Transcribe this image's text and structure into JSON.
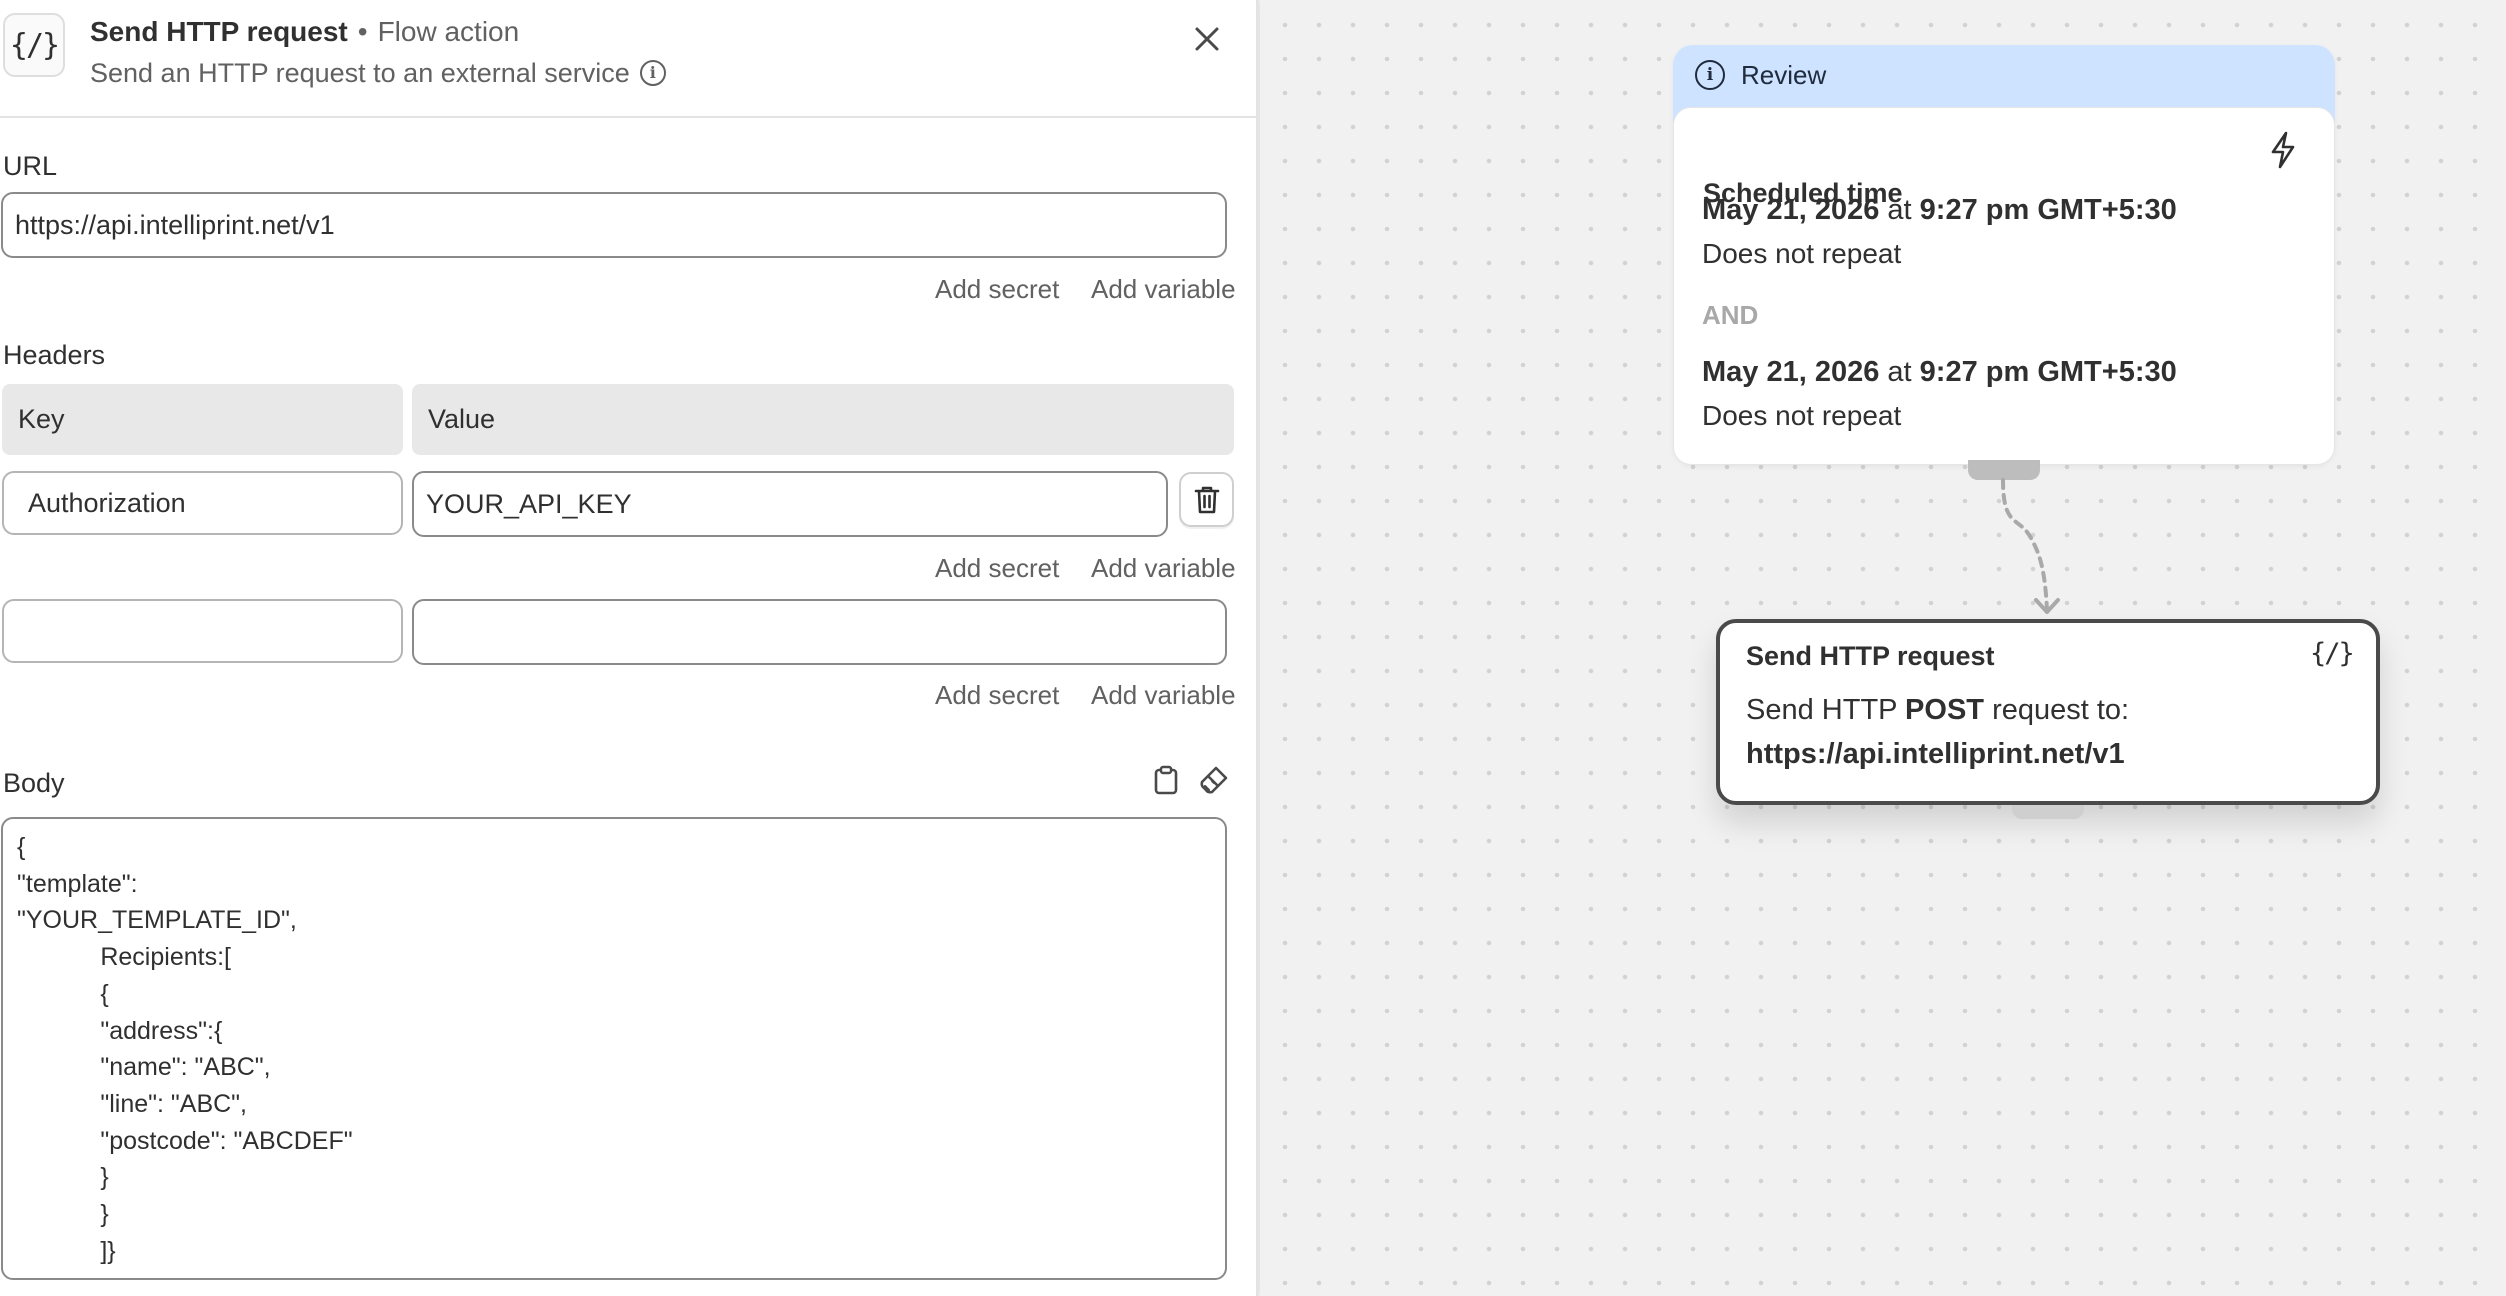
{
  "panel": {
    "icon_glyph": "{/}",
    "title": "Send HTTP request",
    "separator": "•",
    "kind": "Flow action",
    "subtitle": "Send an HTTP request to an external service",
    "icons": {
      "header": "code-braces-icon",
      "info": "info-icon",
      "close": "close-icon"
    }
  },
  "url": {
    "label": "URL",
    "value": "https://api.intelliprint.net/v1",
    "add_secret": "Add secret",
    "add_variable": "Add variable"
  },
  "headers": {
    "label": "Headers",
    "columns": [
      "Key",
      "Value"
    ],
    "rows": [
      {
        "key": "Authorization",
        "value": "YOUR_API_KEY",
        "add_secret": "Add secret",
        "add_variable": "Add variable"
      },
      {
        "key": "",
        "value": "",
        "add_secret": "Add secret",
        "add_variable": "Add variable"
      }
    ],
    "delete_icon": "trash-icon"
  },
  "body": {
    "label": "Body",
    "tool_icons": [
      "clipboard-icon",
      "format-brush-icon"
    ],
    "lines": [
      "{",
      "\"template\":",
      "\"YOUR_TEMPLATE_ID\",",
      "            Recipients:[",
      "            {",
      "            \"address\":{",
      "            \"name\": \"ABC\",",
      "            \"line\": \"ABC\",",
      "            \"postcode\": \"ABCDEF\"",
      "            }",
      "            }",
      "            ]}"
    ]
  },
  "canvas": {
    "review": {
      "header": "Review",
      "title": "Scheduled time",
      "bolt_icon": "lightning-bolt-icon",
      "schedules": [
        {
          "date": "May 21, 2026",
          "at": "at",
          "time": "9:27 pm GMT+5:30",
          "repeat": "Does not repeat"
        },
        {
          "date": "May 21, 2026",
          "at": "at",
          "time": "9:27 pm GMT+5:30",
          "repeat": "Does not repeat"
        }
      ],
      "and": "AND"
    },
    "action": {
      "title": "Send HTTP request",
      "icon_glyph": "{/}",
      "line_prefix": "Send HTTP",
      "method": "POST",
      "line_suffix": "request to:",
      "url": "https://api.intelliprint.net/v1"
    }
  },
  "colors": {
    "review_header_bg": "#cde3ff",
    "text": "#303030",
    "muted": "#616161",
    "canvas_bg": "#f1f1f1"
  }
}
